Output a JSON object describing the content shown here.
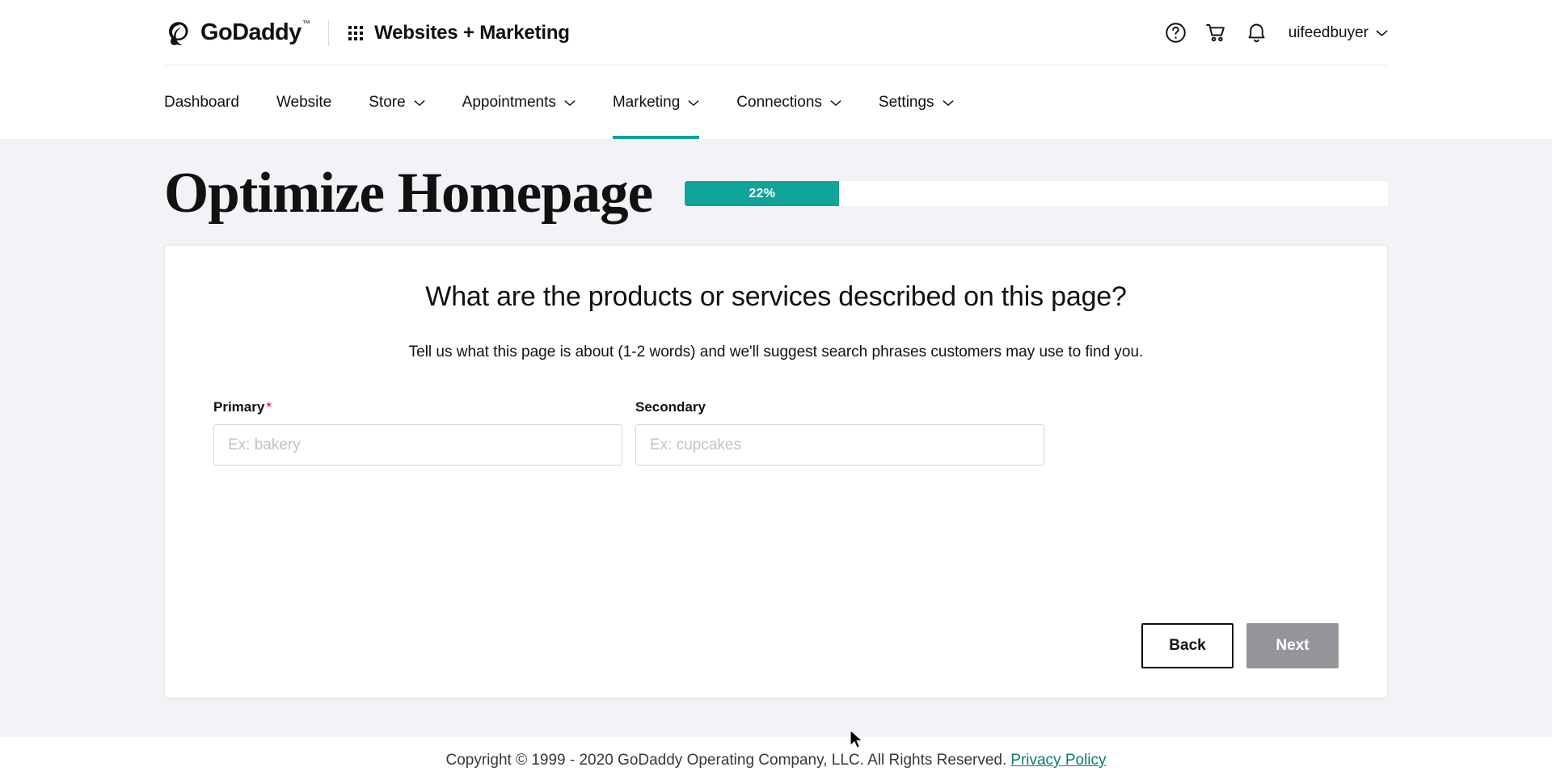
{
  "header": {
    "brand": "GoDaddy",
    "brand_tm": "™",
    "product_name": "Websites + Marketing",
    "app_grid_icon": "app-grid-icon",
    "help_icon": "help-circle-icon",
    "cart_icon": "shopping-cart-icon",
    "bell_icon": "notification-bell-icon",
    "account_name": "uifeedbuyer",
    "account_caret_icon": "chevron-down-icon"
  },
  "nav": {
    "items": [
      {
        "label": "Dashboard",
        "has_caret": false,
        "active": false
      },
      {
        "label": "Website",
        "has_caret": false,
        "active": false
      },
      {
        "label": "Store",
        "has_caret": true,
        "active": false
      },
      {
        "label": "Appointments",
        "has_caret": true,
        "active": false
      },
      {
        "label": "Marketing",
        "has_caret": true,
        "active": true
      },
      {
        "label": "Connections",
        "has_caret": true,
        "active": false
      },
      {
        "label": "Settings",
        "has_caret": true,
        "active": false
      }
    ]
  },
  "page": {
    "title": "Optimize Homepage",
    "progress_percent": 22,
    "progress_label": "22%"
  },
  "card": {
    "heading": "What are the products or services described on this page?",
    "subtext": "Tell us what this page is about (1-2 words) and we'll suggest search phrases customers may use to find you.",
    "fields": [
      {
        "label": "Primary",
        "required": true,
        "required_marker": "*",
        "placeholder": "Ex: bakery",
        "value": ""
      },
      {
        "label": "Secondary",
        "required": false,
        "required_marker": "",
        "placeholder": "Ex: cupcakes",
        "value": ""
      }
    ],
    "back_label": "Back",
    "next_label": "Next",
    "next_disabled": true
  },
  "footer": {
    "copyright": "Copyright © 1999 - 2020 GoDaddy Operating Company, LLC. All Rights Reserved.",
    "privacy_link": "Privacy Policy"
  },
  "colors": {
    "accent_teal": "#0fa39a",
    "link_teal": "#0b7c74",
    "required_red": "#d6002a",
    "disabled_gray": "#939598",
    "page_bg": "#f2f3f6"
  }
}
